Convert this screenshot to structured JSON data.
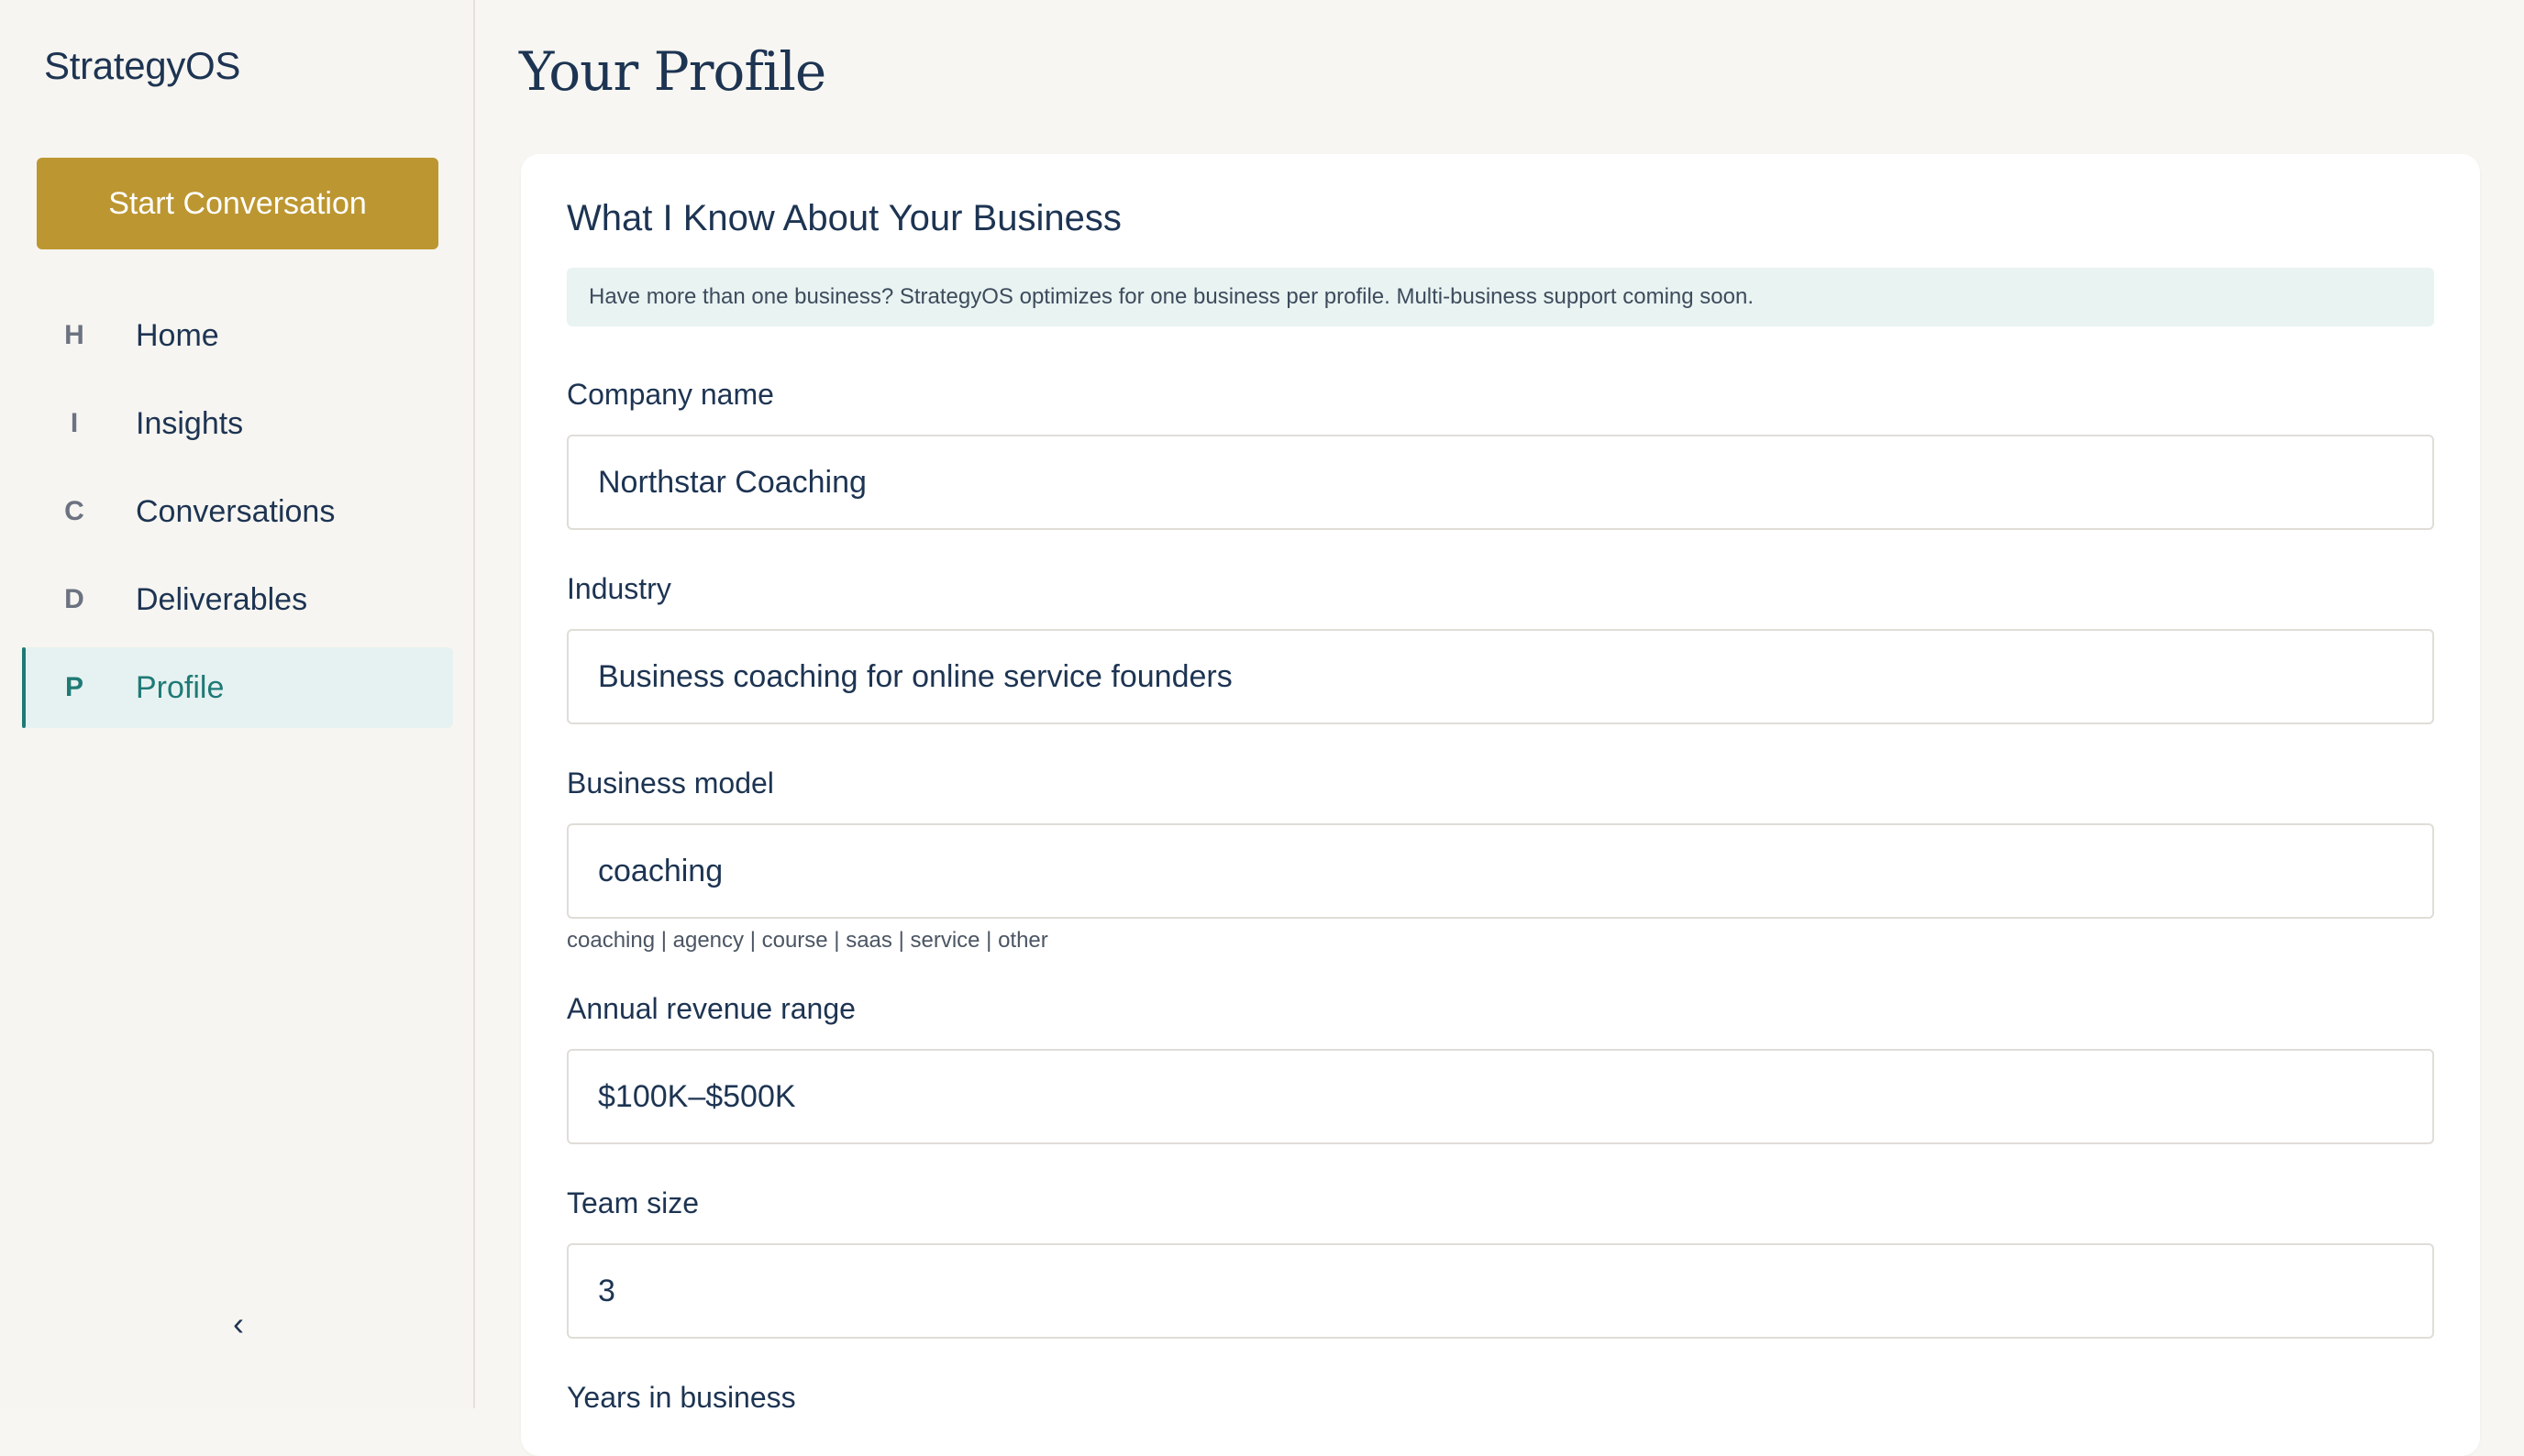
{
  "app": {
    "brand": "StrategyOS",
    "start_button": "Start Conversation",
    "collapse_glyph": "‹"
  },
  "sidebar": {
    "items": [
      {
        "letter": "H",
        "label": "Home",
        "active": false
      },
      {
        "letter": "I",
        "label": "Insights",
        "active": false
      },
      {
        "letter": "C",
        "label": "Conversations",
        "active": false
      },
      {
        "letter": "D",
        "label": "Deliverables",
        "active": false
      },
      {
        "letter": "P",
        "label": "Profile",
        "active": true
      }
    ]
  },
  "page": {
    "title": "Your Profile"
  },
  "card": {
    "heading": "What I Know About Your Business",
    "notice": "Have more than one business? StrategyOS optimizes for one business per profile. Multi-business support coming soon."
  },
  "fields": {
    "company_name": {
      "label": "Company name",
      "value": "Northstar Coaching"
    },
    "industry": {
      "label": "Industry",
      "value": "Business coaching for online service founders"
    },
    "business_model": {
      "label": "Business model",
      "value": "coaching",
      "hint": "coaching | agency | course | saas | service | other"
    },
    "revenue_range": {
      "label": "Annual revenue range",
      "value": "$100K–$500K"
    },
    "team_size": {
      "label": "Team size",
      "value": "3"
    },
    "years_in_business": {
      "label": "Years in business"
    }
  },
  "colors": {
    "accent_gold": "#bc9631",
    "accent_teal": "#1f7a76",
    "navy_text": "#1d3452",
    "page_bg": "#f8f6f2"
  }
}
